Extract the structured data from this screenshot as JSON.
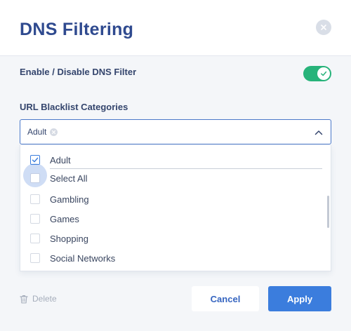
{
  "dialog": {
    "title": "DNS Filtering",
    "close_icon": "close-icon"
  },
  "filter_toggle": {
    "label": "Enable / Disable DNS Filter",
    "enabled": true,
    "color": "#27b37a"
  },
  "blacklist": {
    "label": "URL Blacklist Categories",
    "selected_tags": [
      "Adult"
    ],
    "expanded": true,
    "options": [
      {
        "label": "Adult",
        "checked": true
      },
      {
        "label": "Select All",
        "checked": false,
        "focused": true
      },
      {
        "label": "Gambling",
        "checked": false
      },
      {
        "label": "Games",
        "checked": false
      },
      {
        "label": "Shopping",
        "checked": false
      },
      {
        "label": "Social Networks",
        "checked": false
      }
    ]
  },
  "footer": {
    "delete_label": "Delete",
    "cancel_label": "Cancel",
    "apply_label": "Apply"
  },
  "colors": {
    "title": "#2f4a8f",
    "accent": "#3b7ddd",
    "toggle_on": "#27b37a",
    "muted": "#a5adbb"
  }
}
